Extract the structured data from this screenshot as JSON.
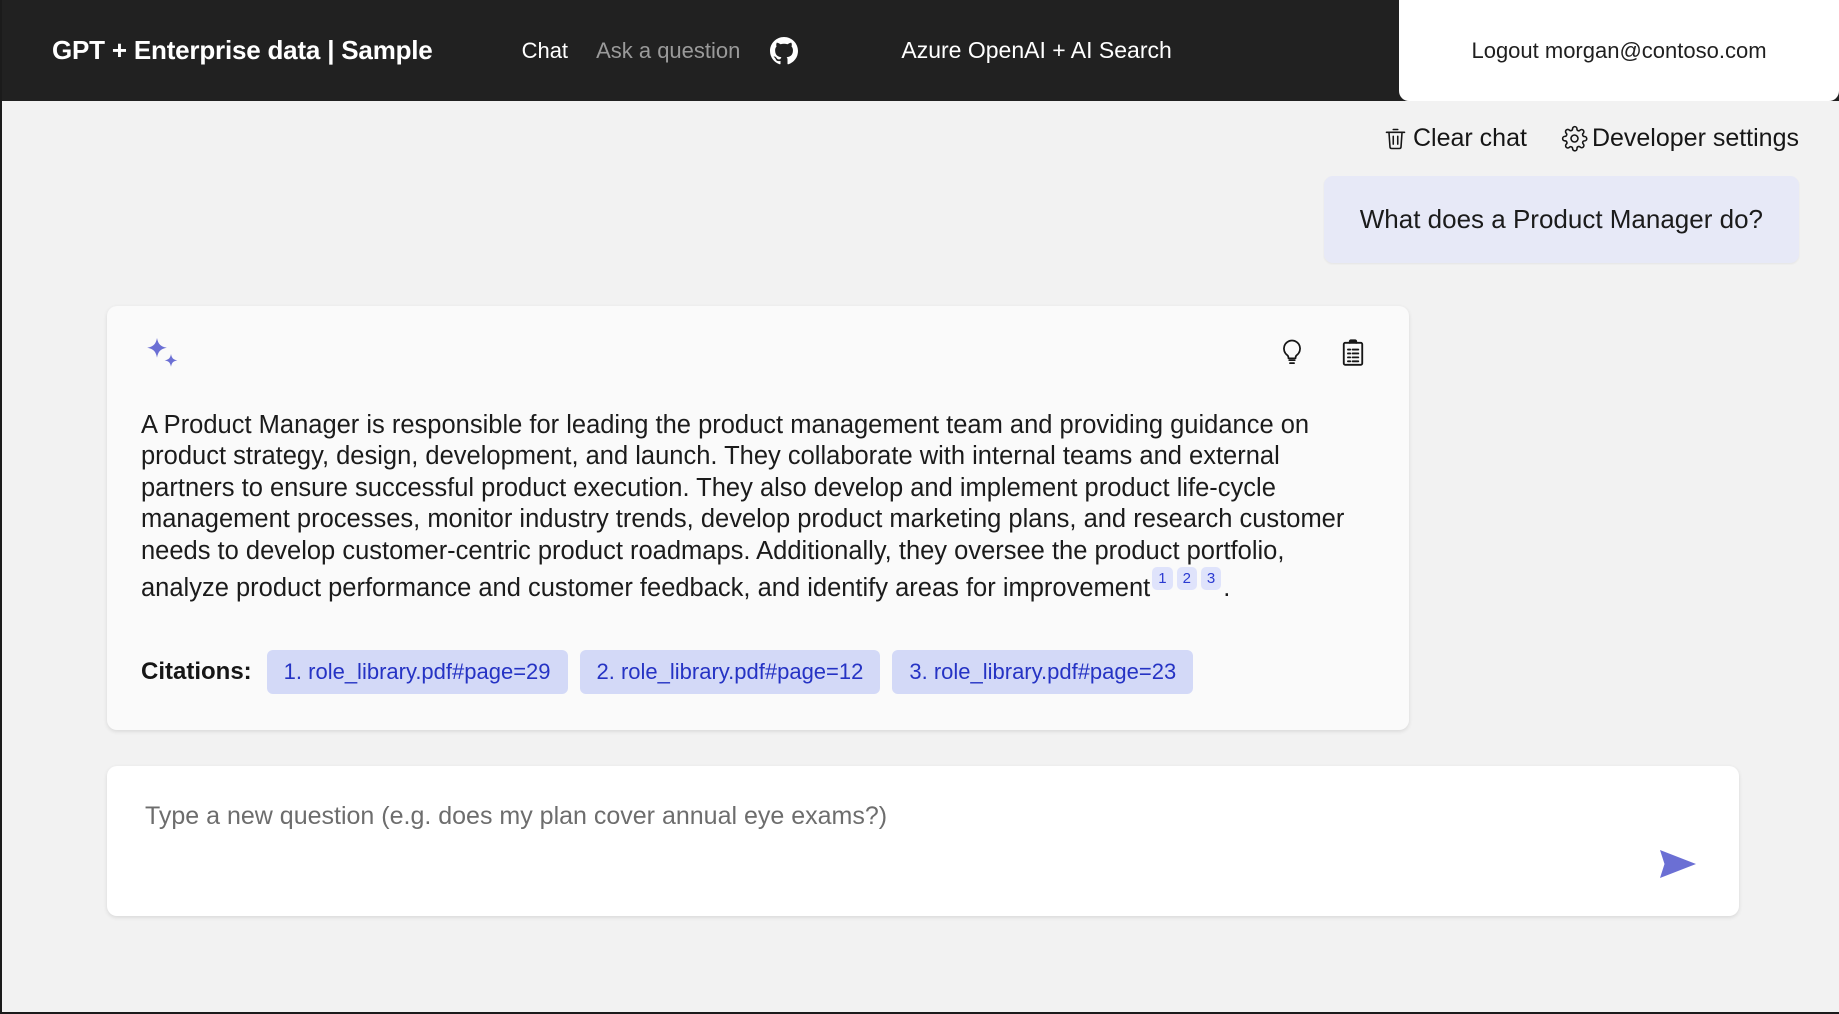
{
  "header": {
    "brand": "GPT + Enterprise data | Sample",
    "nav": [
      {
        "label": "Chat",
        "state": "active",
        "name": "nav-link-chat"
      },
      {
        "label": "Ask a question",
        "state": "inactive",
        "name": "nav-link-ask-a-question"
      }
    ],
    "github_icon": "github-icon",
    "subtitle": "Azure OpenAI + AI Search",
    "logout_label": "Logout morgan@contoso.com",
    "background_color": "#212121"
  },
  "commands": {
    "clear_chat": {
      "label": "Clear chat",
      "icon": "trash-icon"
    },
    "developer_settings": {
      "label": "Developer settings",
      "icon": "gear-icon"
    }
  },
  "conversation": {
    "user_message": "What does a Product Manager do?",
    "answer": {
      "avatar_icon": "sparkle-icon",
      "actions": [
        {
          "icon": "lightbulb-icon",
          "name": "show-thought-process-button"
        },
        {
          "icon": "clipboard-icon",
          "name": "show-supporting-content-button"
        }
      ],
      "text_part_1": "A Product Manager is responsible for leading the product management team and providing guidance on product strategy, design, development, and launch. They collaborate with internal teams and external partners to ensure successful product execution. They also develop and implement product life-cycle management processes, monitor industry trends, develop product marketing plans, and research customer needs to develop customer-centric product roadmaps. Additionally, they oversee the product portfolio, analyze product performance and customer feedback, and identify areas for improvement",
      "superscripts": [
        "1",
        "2",
        "3"
      ],
      "text_part_2": ".",
      "citations_label": "Citations:",
      "citations": [
        "1. role_library.pdf#page=29",
        "2. role_library.pdf#page=12",
        "3. role_library.pdf#page=23"
      ]
    }
  },
  "input": {
    "value": "",
    "placeholder": "Type a new question (e.g. does my plan cover annual eye exams?)",
    "send_icon": "send-icon"
  },
  "colors": {
    "accent": "#6b6fd4",
    "user_bubble": "#e7e9f7",
    "citation_pill": "#d3d9f7",
    "citation_text": "#2533c4",
    "page_background": "#f2f2f2",
    "header_background": "#212121"
  }
}
